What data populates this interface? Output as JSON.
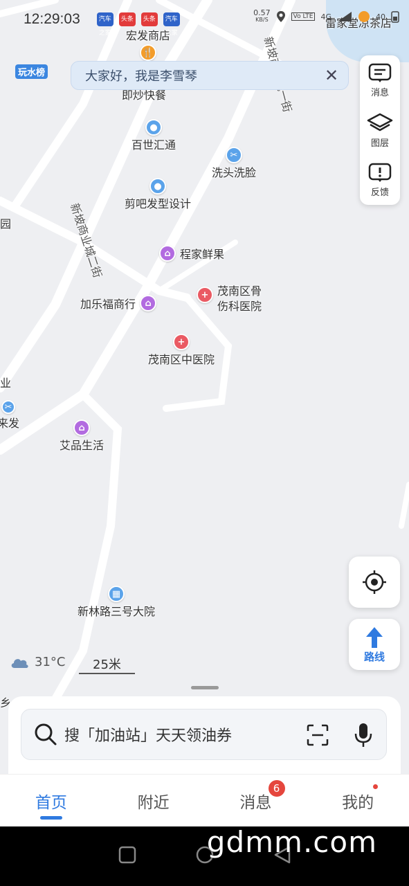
{
  "status_bar": {
    "time": "12:29:03",
    "apps": [
      "汽车之家",
      "头条",
      "头条",
      "汽车之家"
    ],
    "net_speed": "0.57",
    "net_unit": "KB/S",
    "volte": "Vo LTE",
    "signal": "4G",
    "battery": "40"
  },
  "map": {
    "badge": "玩水榜",
    "pois": [
      {
        "name": "宏发商店"
      },
      {
        "name": "即炒快餐"
      },
      {
        "name": "百世汇通"
      },
      {
        "name": "洗头洗脸"
      },
      {
        "name": "剪吧发型设计"
      },
      {
        "name": "程家鲜果"
      },
      {
        "name": "茂南区骨\n伤科医院"
      },
      {
        "name": "加乐福商行"
      },
      {
        "name": "茂南区中医院"
      },
      {
        "name": "艾品生活"
      },
      {
        "name": "新林路三号大院"
      },
      {
        "name": "来发"
      },
      {
        "name": "园"
      },
      {
        "name": "业"
      },
      {
        "name": "乡"
      },
      {
        "name": "雷家堂凉茶店"
      }
    ],
    "roads": [
      {
        "name": "新坡商业城二街"
      },
      {
        "name": "新坡商业城一街"
      }
    ]
  },
  "greeting": {
    "text": "大家好，我是李雪琴"
  },
  "side_panel": [
    {
      "label": "消息",
      "icon": "message-icon"
    },
    {
      "label": "图层",
      "icon": "layers-icon"
    },
    {
      "label": "反馈",
      "icon": "feedback-icon"
    }
  ],
  "route_button": {
    "label": "路线"
  },
  "weather": {
    "temp": "31°C"
  },
  "scale": {
    "label": "25米"
  },
  "search": {
    "placeholder": "搜「加油站」天天领油券"
  },
  "tabs": [
    {
      "label": "首页",
      "active": true
    },
    {
      "label": "附近"
    },
    {
      "label": "消息",
      "badge": "6"
    },
    {
      "label": "我的",
      "dot": true
    }
  ],
  "watermark": "gdmm.com",
  "colors": {
    "accent": "#2f7ae0",
    "badge_red": "#e5463d"
  }
}
